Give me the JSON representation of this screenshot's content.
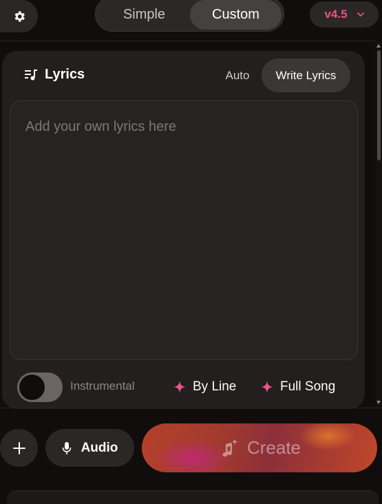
{
  "header": {
    "settings_icon": "gear-icon",
    "modes": [
      "Simple",
      "Custom"
    ],
    "active_mode": "Custom",
    "version": "v4.5",
    "version_icon": "chevron-down-icon"
  },
  "lyrics": {
    "title": "Lyrics",
    "icon": "lyrics-icon",
    "tabs": {
      "auto": "Auto",
      "write": "Write Lyrics"
    },
    "active_tab": "Write Lyrics",
    "placeholder": "Add your own lyrics here",
    "value": "",
    "instrumental_label": "Instrumental",
    "instrumental_on": false,
    "by_line": "By Line",
    "full_song": "Full Song",
    "sparkle_icon": "sparkle-icon"
  },
  "actions": {
    "add_icon": "plus-icon",
    "audio_label": "Audio",
    "audio_icon": "microphone-icon",
    "create_label": "Create",
    "create_icon": "music-sparkle-icon"
  },
  "colors": {
    "accent": "#f0508c",
    "create_gradient_start": "#b4402c",
    "create_gradient_end": "#c0472a",
    "background": "#110d0c",
    "card": "#221f1e"
  }
}
